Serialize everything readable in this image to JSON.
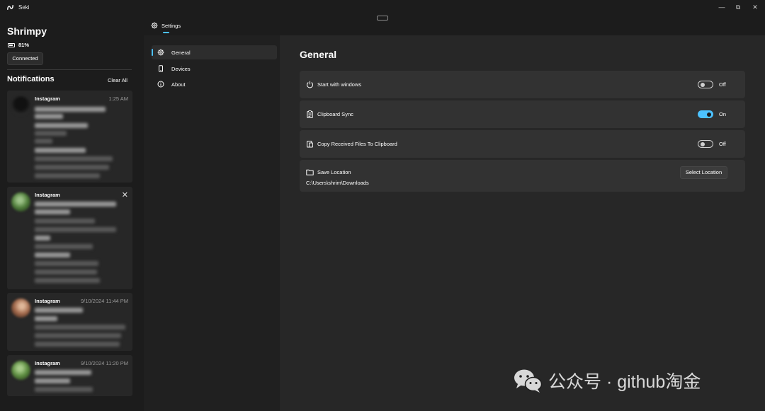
{
  "app": {
    "title": "Seki"
  },
  "window": {
    "minimize": "—",
    "maximize": "⧉",
    "close": "✕"
  },
  "device": {
    "name": "Shrimpy",
    "battery": "81%",
    "status_button": "Connected"
  },
  "notifications": {
    "title": "Notifications",
    "clear_label": "Clear All",
    "items": [
      {
        "app": "Instagram",
        "time": "1:25 AM"
      },
      {
        "app": "Instagram",
        "time": ""
      },
      {
        "app": "Instagram",
        "time": "9/10/2024 11:44 PM"
      },
      {
        "app": "Instagram",
        "time": "9/10/2024 11:20 PM"
      }
    ]
  },
  "header": {
    "tab_label": "Settings"
  },
  "nav": {
    "items": [
      {
        "label": "General",
        "icon": "gear-icon",
        "active": true
      },
      {
        "label": "Devices",
        "icon": "phone-icon",
        "active": false
      },
      {
        "label": "About",
        "icon": "info-icon",
        "active": false
      }
    ]
  },
  "general": {
    "title": "General",
    "start_with_windows": {
      "label": "Start with windows",
      "state": "Off",
      "on": false
    },
    "clipboard_sync": {
      "label": "Clipboard Sync",
      "state": "On",
      "on": true
    },
    "copy_received": {
      "label": "Copy Received Files To Clipboard",
      "state": "Off",
      "on": false
    },
    "save_location": {
      "label": "Save Location",
      "path": "C:\\Users\\shrim\\Downloads",
      "button": "Select Location"
    }
  },
  "watermark": {
    "text": "公众号 · github淘金"
  },
  "colors": {
    "accent": "#4cc2ff",
    "background": "#1c1c1c",
    "panel": "#272727",
    "row": "#323232"
  }
}
